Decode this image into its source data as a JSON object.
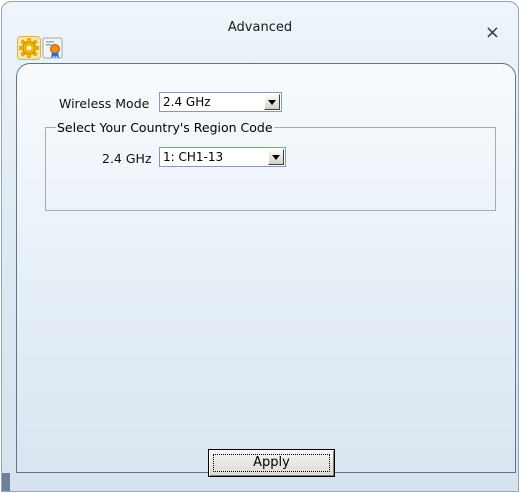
{
  "window": {
    "title": "Advanced",
    "close_label": "×"
  },
  "tabs": [
    {
      "icon": "gear-icon"
    },
    {
      "icon": "certificate-badge-icon"
    }
  ],
  "wireless_mode": {
    "label": "Wireless Mode",
    "value": "2.4 GHz"
  },
  "region": {
    "group_label": "Select Your Country's Region Code",
    "band_label": "2.4 GHz",
    "value": "1: CH1-13"
  },
  "apply_label": "Apply"
}
